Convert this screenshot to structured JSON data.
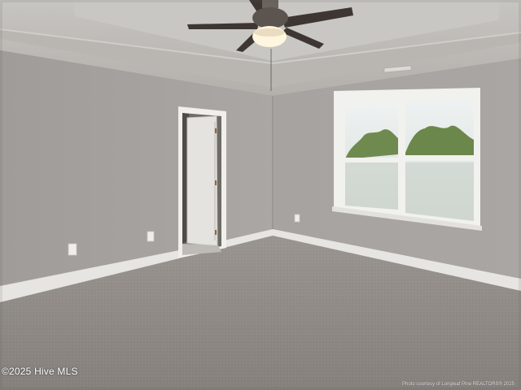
{
  "photo": {
    "subject": "empty-bedroom",
    "colors": {
      "wall": "#a4a19f",
      "ceiling": "#bcbab6",
      "carpet": "#8e8985",
      "trim": "#e9e8e4",
      "fan_blade": "#3e3632",
      "window_glass": "#dfe6e6",
      "foliage": "#6f8a4e"
    }
  },
  "watermark": {
    "left": "©2025 Hive MLS",
    "right": "Photo courtesy of Longleaf Pine REALTORS® 2025"
  }
}
